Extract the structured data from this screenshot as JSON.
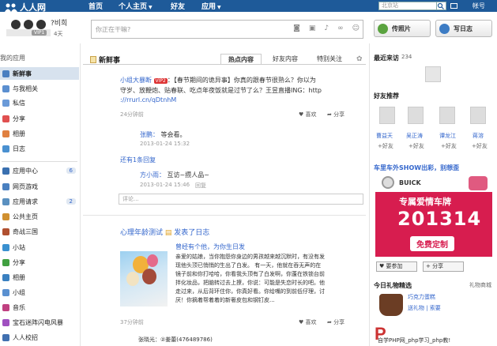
{
  "topbar": {
    "logo": "人人网",
    "nav": [
      "首页",
      "个人主页",
      "好友",
      "应用"
    ],
    "search_placeholder": "北京站",
    "account": "帐号"
  },
  "profile": {
    "name": "?비희",
    "vip": "VIP1",
    "days": "4天"
  },
  "status": {
    "placeholder": "你正在干嘛?"
  },
  "buttons": {
    "photo": "传照片",
    "diary": "写日志"
  },
  "sidebar": {
    "title": "我的应用",
    "items": [
      {
        "label": "新鲜事",
        "color": "#4a7fc0"
      },
      {
        "label": "与我相关",
        "color": "#5b8fd0"
      },
      {
        "label": "私信",
        "color": "#6a9ad8"
      },
      {
        "label": "分享",
        "color": "#e05050"
      },
      {
        "label": "相册",
        "color": "#e08040"
      },
      {
        "label": "日志",
        "color": "#4a90d0"
      }
    ],
    "apps": [
      {
        "label": "应用中心",
        "badge": "6",
        "color": "#3a70b0"
      },
      {
        "label": "网页游戏",
        "color": "#4a80c0"
      },
      {
        "label": "应用请求",
        "badge": "2",
        "color": "#5a90c0"
      },
      {
        "label": "公共主页",
        "color": "#d09030"
      },
      {
        "label": "奇战三国",
        "color": "#b05030"
      },
      {
        "label": "小站",
        "color": "#3a90d0"
      },
      {
        "label": "分享",
        "color": "#40a040"
      },
      {
        "label": "相册",
        "color": "#3a80c0"
      },
      {
        "label": "小组",
        "color": "#5a90d0"
      },
      {
        "label": "音乐",
        "color": "#c04080"
      },
      {
        "label": "宝石迷阵闪电风暴",
        "color": "#a050c0"
      },
      {
        "label": "人人校招",
        "color": "#4070b0"
      }
    ]
  },
  "feed": {
    "title": "新鲜事",
    "tabs": [
      "热点内容",
      "好友内容",
      "特别关注"
    ]
  },
  "post1": {
    "author": "小组大暴断",
    "vip": "VIP2",
    "line1": "：【春节期间的诡异事】你真的跟春节很熟么？你以为",
    "line2": "守岁、放鞭炮、贴春联、吃点年夜饭就是过节了么？王昱直播ING：http",
    "line3": "://rrurl.cn/qDtnhM",
    "time": "24分钟前",
    "like": "喜欢",
    "share": "分享"
  },
  "comment1": {
    "author": "张鹏：",
    "text": "等会看。",
    "time": "2013-01-24 15:32"
  },
  "reply_link": "还有1条回复",
  "comment2": {
    "author": "方小雨：",
    "text": "互访~攒人品~",
    "time": "2013-01-24 15:46",
    "reply": "回复"
  },
  "comment_placeholder": "评论...",
  "post2": {
    "author": "心理年龄测试",
    "action": "发表了日志",
    "subtitle": "曾经有个他，为你生日发",
    "lines": [
      "亲爱的姑娘，当你抱怨你身边的男孩越来越沉默时，有没有发",
      "现他头顶已悄悄的生出了白发。  有一天，他就在吞无声的在",
      "镜子前和你打哈哈，你看我头顶有了白发啊，你蓬在铁锁台前",
      "拌化妆品，把脑转过去上撩，你说：可能是失恋时长的吧。他",
      "走过来，从后背环住你，你真好看。你给嘴的到前低仔理，讨",
      "厌！你摘着帮着着的新奢皮包和钢钉皮..."
    ],
    "time": "37分钟前",
    "like": "喜欢",
    "share": "分享",
    "commenter": "张晓光：②姜蕾(476489786)"
  },
  "right": {
    "recent": "最近来访",
    "recent_count": "234",
    "suggest": "好友推荐",
    "friends": [
      {
        "name": "曹益天",
        "action": "好友"
      },
      {
        "name": "吴正涛",
        "action": "好友"
      },
      {
        "name": "谭龙江",
        "action": "好友"
      },
      {
        "name": "蒋溶",
        "action": "好友"
      }
    ],
    "ad_title": "车里车外SHOW出彩，别想歪",
    "ad_brand": "BUICK",
    "ad_banner": "专属爱情车牌",
    "ad_number": "201314",
    "ad_cta": "免费定制",
    "btn_like": "要参加",
    "btn_share": "分享",
    "gift_title": "今日礼物精选",
    "gift_link": "礼物商城",
    "gift_name": "巧克力蛋糕",
    "gift_sub": "送礼物 | 索要",
    "watermark": "自学PHP网_php学习_php教!"
  }
}
